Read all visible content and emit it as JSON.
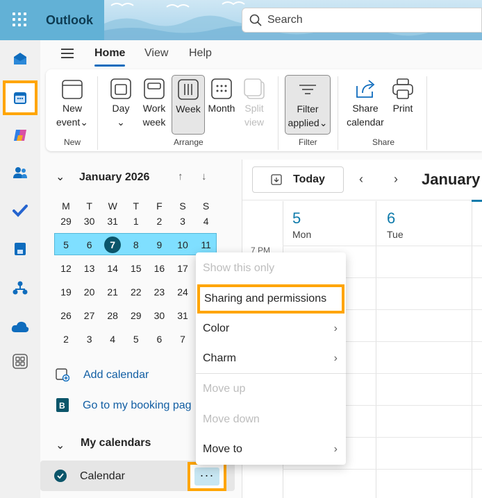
{
  "app": {
    "title": "Outlook"
  },
  "search": {
    "label": "Search"
  },
  "ribbon_tabs": [
    "Home",
    "View",
    "Help"
  ],
  "ribbon": {
    "new_event": [
      "New",
      "event"
    ],
    "day": "Day",
    "work_week": [
      "Work",
      "week"
    ],
    "week": "Week",
    "month": "Month",
    "split_view": [
      "Split",
      "view"
    ],
    "filter": [
      "Filter",
      "applied"
    ],
    "share": [
      "Share",
      "calendar"
    ],
    "print": "Print",
    "groups": {
      "new": "New",
      "arrange": "Arrange",
      "filter": "Filter",
      "share": "Share"
    }
  },
  "mini_calendar": {
    "title": "January 2026",
    "weekdays": [
      "M",
      "T",
      "W",
      "T",
      "F",
      "S",
      "S"
    ],
    "weeks": [
      [
        "29",
        "30",
        "31",
        "1",
        "2",
        "3",
        "4"
      ],
      [
        "5",
        "6",
        "7",
        "8",
        "9",
        "10",
        "11"
      ],
      [
        "12",
        "13",
        "14",
        "15",
        "16",
        "17"
      ],
      [
        "19",
        "20",
        "21",
        "22",
        "23",
        "24"
      ],
      [
        "26",
        "27",
        "28",
        "29",
        "30",
        "31"
      ],
      [
        "2",
        "3",
        "4",
        "5",
        "6",
        "7"
      ]
    ],
    "today": "7"
  },
  "sidebar": {
    "add_calendar": "Add calendar",
    "booking": "Go to my booking pag",
    "my_calendars": "My calendars",
    "calendar_name": "Calendar",
    "more": "···"
  },
  "toolbar": {
    "today": "Today",
    "month_heading": "January"
  },
  "days": [
    {
      "num": "5",
      "name": "Mon"
    },
    {
      "num": "6",
      "name": "Tue"
    }
  ],
  "time_label": "7 PM",
  "context_menu": {
    "show_only": "Show this only",
    "sharing": "Sharing and permissions",
    "color": "Color",
    "charm": "Charm",
    "move_up": "Move up",
    "move_down": "Move down",
    "move_to": "Move to"
  },
  "colors": {
    "accent": "#0f6cbd",
    "highlight": "#ffa500",
    "week_highlight": "#7fdfff",
    "today": "#0b556a"
  }
}
